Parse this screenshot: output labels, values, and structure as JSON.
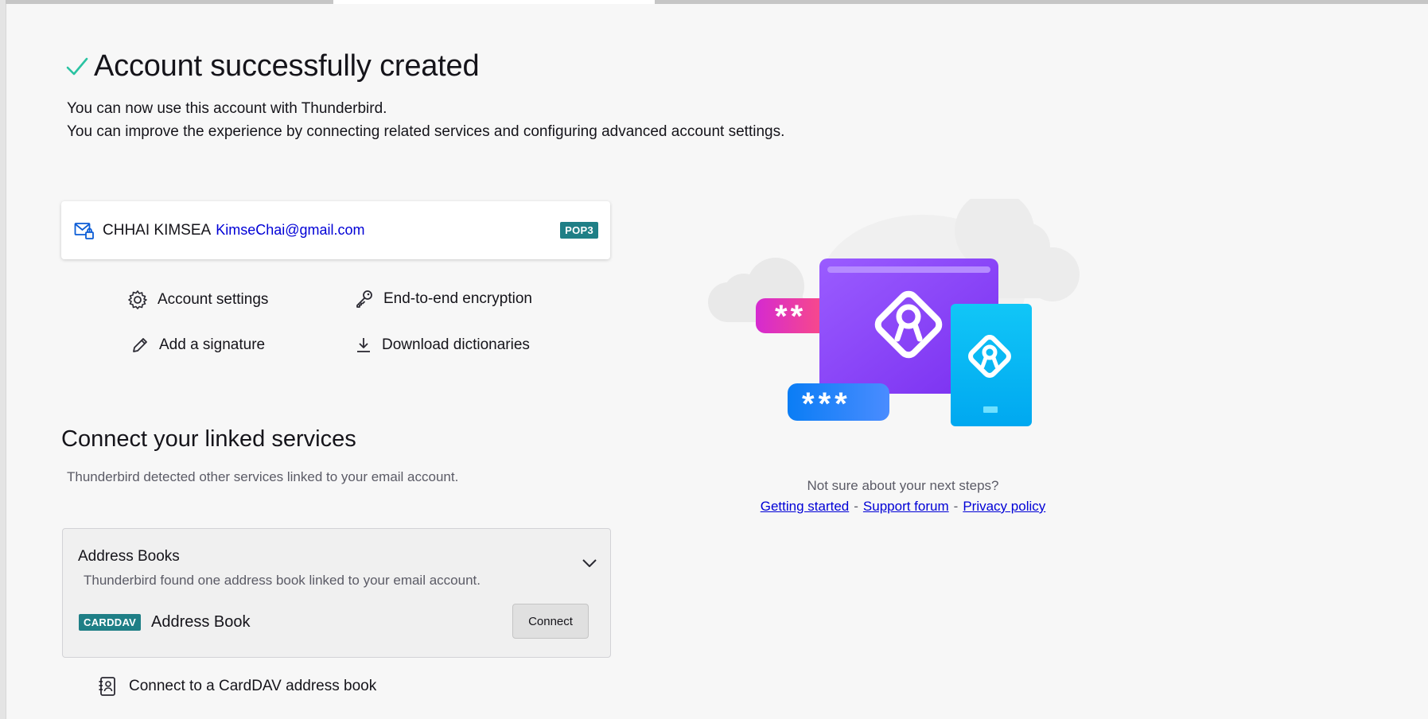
{
  "header": {
    "title": "Account successfully created",
    "subtitle_line1": "You can now use this account with Thunderbird.",
    "subtitle_line2": "You can improve the experience by connecting related services and configuring advanced account settings."
  },
  "account": {
    "name": "CHHAI KIMSEA",
    "email": "KimseChai@gmail.com",
    "protocol_badge": "POP3"
  },
  "actions": {
    "account_settings": "Account settings",
    "encryption": "End-to-end encryption",
    "signature": "Add a signature",
    "dictionaries": "Download dictionaries"
  },
  "linked_services": {
    "title": "Connect your linked services",
    "subtitle": "Thunderbird detected other services linked to your email account.",
    "address_books": {
      "title": "Address Books",
      "subtitle": "Thunderbird found one address book linked to your email account.",
      "badge": "CARDDAV",
      "book_name": "Address Book",
      "connect_label": "Connect"
    },
    "carddav_link": "Connect to a CardDAV address book"
  },
  "help": {
    "question": "Not sure about your next steps?",
    "getting_started": "Getting started",
    "support_forum": "Support forum",
    "privacy_policy": "Privacy policy",
    "separator": "-"
  },
  "illustration": {
    "password_short": "**",
    "password_long": "***"
  },
  "colors": {
    "accent_teal": "#1f7f86",
    "link_blue": "#0000d6",
    "success_green": "#2ac3a2",
    "purple": "#9059ff",
    "cyan": "#00c8f5"
  }
}
